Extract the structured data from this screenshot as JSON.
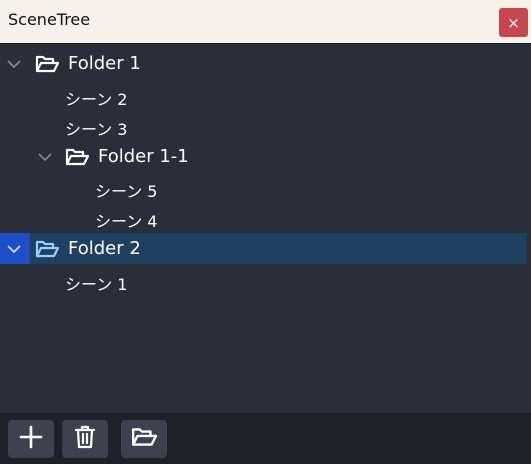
{
  "window": {
    "title": "SceneTree",
    "close_glyph": "×"
  },
  "tree": {
    "folder1": {
      "label": "Folder 1",
      "expanded": true
    },
    "scene2": {
      "label": "シーン 2"
    },
    "scene3": {
      "label": "シーン 3"
    },
    "folder11": {
      "label": "Folder 1-1",
      "expanded": true
    },
    "scene5": {
      "label": "シーン 5"
    },
    "scene4": {
      "label": "シーン 4"
    },
    "folder2": {
      "label": "Folder 2",
      "expanded": true,
      "selected": true
    },
    "scene1": {
      "label": "シーン 1"
    }
  },
  "toolbar": {
    "add_icon": "plus-icon",
    "delete_icon": "trash-icon",
    "folder_icon": "folder-open-icon"
  },
  "colors": {
    "background": "#2a2d3a",
    "titlebar": "#f7f1ea",
    "close": "#c8474f",
    "selection": "#1f4060",
    "selection_accent": "#1e4ec9",
    "folder_selected": "#9ad0ff"
  }
}
